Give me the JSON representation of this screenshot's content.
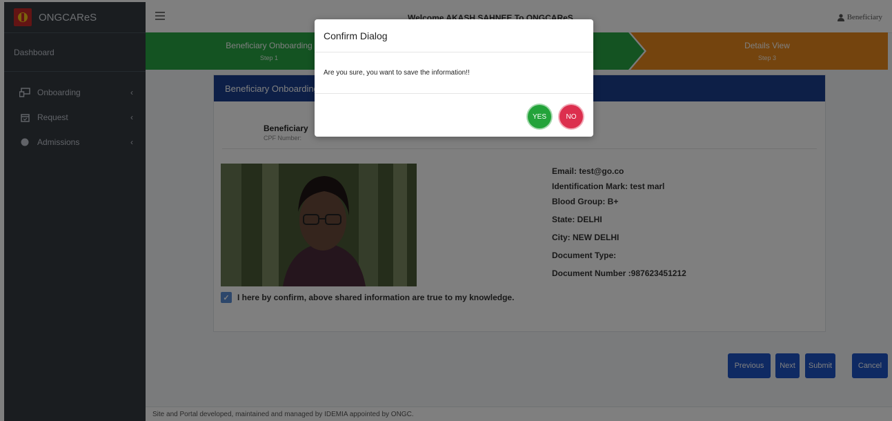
{
  "brand": {
    "name": "ONGCAReS",
    "logo_text": "ONGC"
  },
  "sidebar": {
    "dashboard": "Dashboard",
    "items": [
      {
        "label": "Onboarding",
        "icon": "onboarding-icon"
      },
      {
        "label": "Request",
        "icon": "calendar-icon"
      },
      {
        "label": "Admissions",
        "icon": "circle-icon"
      }
    ]
  },
  "topbar": {
    "welcome": "Welcome AKASH SAHNEE To ONGCAReS",
    "user_label": "Beneficiary"
  },
  "stepper": {
    "steps": [
      {
        "title": "Beneficiary Onboarding",
        "sub": "Step 1",
        "color": "#28a745"
      },
      {
        "title": "",
        "sub": "",
        "color": "#28a745"
      },
      {
        "title": "Details View",
        "sub": "Step 3",
        "color": "#e8891d"
      }
    ]
  },
  "card": {
    "header": "Beneficiary Onboarding",
    "beneficiary_name": "Beneficiary",
    "cpf_label": "CPF Number: ",
    "details": [
      "Email: test@go.co",
      "Identification Mark: test marl",
      "Blood Group: B+",
      "State: DELHI",
      "City: NEW DELHI",
      "Document Type:",
      "Document Number :987623451212"
    ],
    "confirm_text": "I here by confirm, above shared information are true to my knowledge.",
    "confirm_checked": true
  },
  "buttons": {
    "previous": "Previous",
    "next": "Next",
    "submit": "Submit",
    "cancel": "Cancel"
  },
  "footer": "Site and Portal developed, maintained and managed by IDEMIA appointed by ONGC.",
  "dialog": {
    "title": "Confirm Dialog",
    "message": "Are you sure, you want to save the information!!",
    "yes": "YES",
    "no": "NO"
  }
}
